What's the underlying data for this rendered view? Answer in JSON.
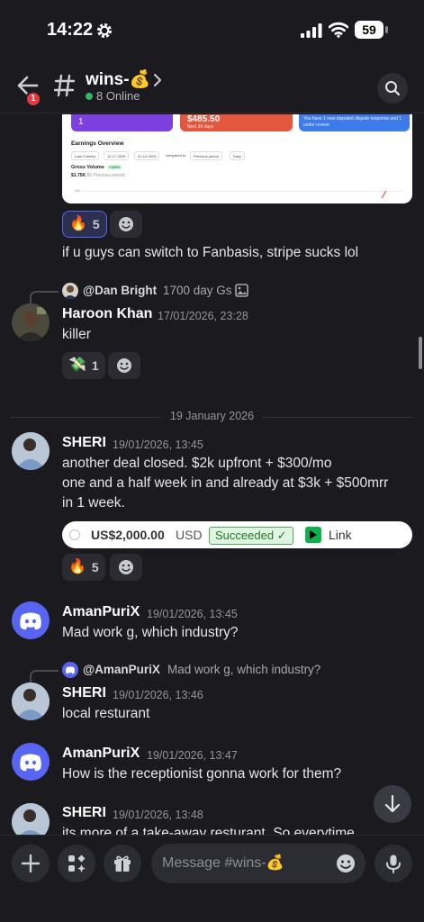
{
  "status_bar": {
    "time": "14:22",
    "battery": "59"
  },
  "header": {
    "back_badge": "1",
    "channel_name": "wins-💰",
    "online": "8 Online"
  },
  "embed_image": {
    "stat1": "1",
    "stat2": "$485.50",
    "stat2_sub": "Next 30 days",
    "stat3": "You have 1 new disputed dispute response and 1 under review",
    "title": "Earnings Overview",
    "chips": [
      "Last 4 weeks",
      "12-17-2025",
      "01-14-2026",
      "compared to",
      "Previous period",
      "Daily"
    ],
    "gross_label": "Gross Volume",
    "gross_pct": "+100%",
    "gross_value": "$1.75K",
    "gross_prev": "$0 Previous period",
    "axis_label": "$4K"
  },
  "messages": [
    {
      "text": "if u guys can switch to Fanbasis, stripe sucks lol",
      "reactions": [
        {
          "emoji": "🔥",
          "count": "5",
          "me": true
        }
      ]
    },
    {
      "reply_to": {
        "name": "@Dan Bright",
        "text": "1700 day Gs"
      },
      "author": "Haroon Khan",
      "time": "17/01/2026, 23:28",
      "text": "killer",
      "reactions": [
        {
          "emoji": "💸",
          "count": "1"
        }
      ]
    },
    {
      "author": "SHERI",
      "time": "19/01/2026, 13:45",
      "lines": [
        "another deal closed. $2k upfront + $300/mo",
        "one and a half week in and already at $3k  + $500mrr",
        "in 1 week."
      ],
      "payment": {
        "amount": "US$2,000.00",
        "currency": "USD",
        "status": "Succeeded ✓",
        "link": "Link"
      },
      "reactions": [
        {
          "emoji": "🔥",
          "count": "5"
        }
      ]
    },
    {
      "author": "AmanPuriX",
      "time": "19/01/2026, 13:45",
      "text": "Mad work g, which industry?"
    },
    {
      "reply_to": {
        "name": "@AmanPuriX",
        "text": "Mad work g, which industry?"
      },
      "author": "SHERI",
      "time": "19/01/2026, 13:46",
      "text": "local resturant"
    },
    {
      "author": "AmanPuriX",
      "time": "19/01/2026, 13:47",
      "text": "How is the receptionist gonna work for them?"
    },
    {
      "author": "SHERI",
      "time": "19/01/2026, 13:48",
      "text": "its more of a take-away resturant. So everytime"
    }
  ],
  "date_divider": "19 January 2026",
  "composer": {
    "placeholder": "Message #wins-💰"
  },
  "colors": {
    "background": "#1b1b1f",
    "accent": "#5865f2",
    "online": "#2fbb63",
    "badge": "#e23a40"
  },
  "icons": [
    "gear-icon",
    "signal-icon",
    "wifi-icon",
    "back-arrow-icon",
    "hash-icon",
    "chevron-right-icon",
    "search-icon",
    "add-reaction-icon",
    "image-icon",
    "discord-icon",
    "arrow-down-icon",
    "plus-icon",
    "apps-icon",
    "gift-icon",
    "emoji-icon",
    "mic-icon",
    "link-logo-icon"
  ]
}
